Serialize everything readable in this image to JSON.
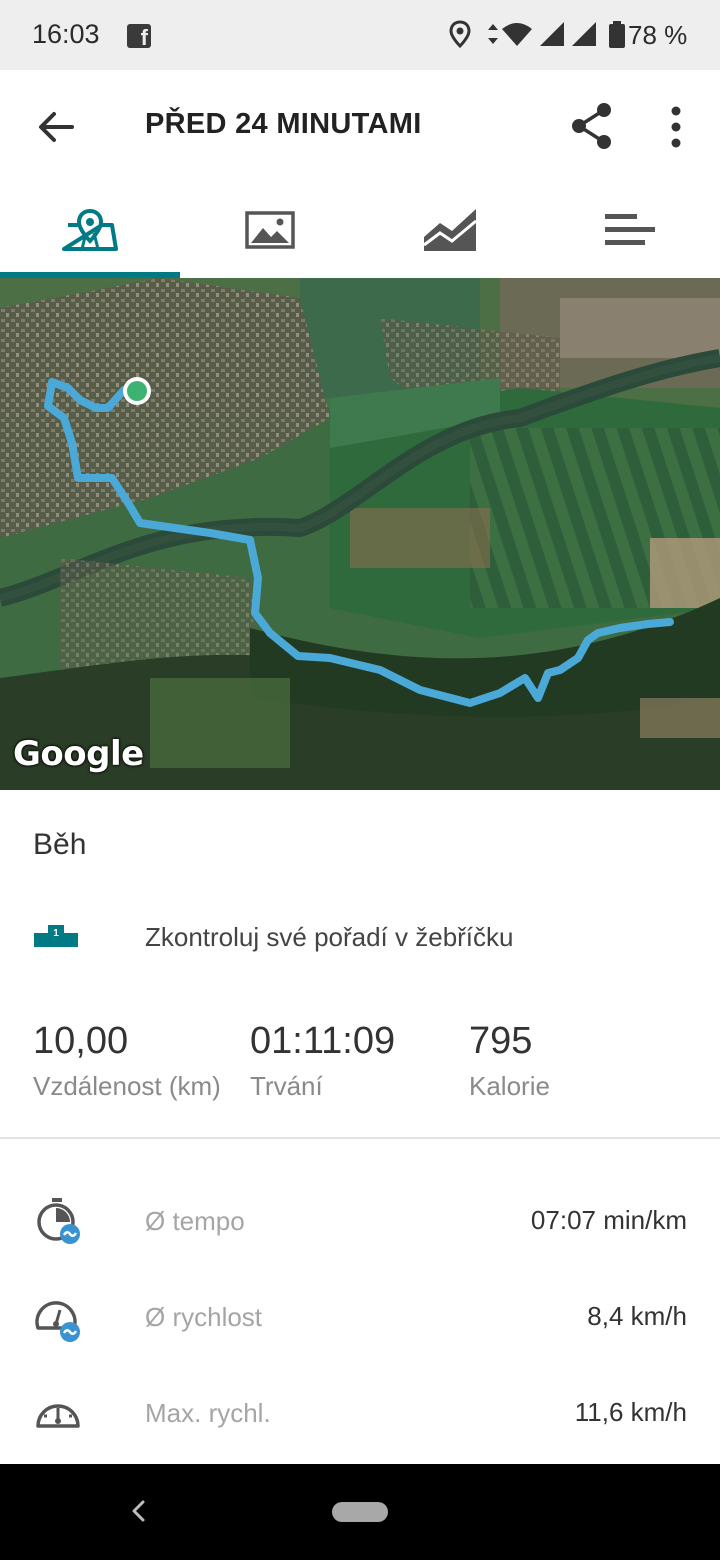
{
  "status_bar": {
    "time": "16:03",
    "battery_percent": "78 %",
    "icons": [
      "facebook-icon",
      "location-icon",
      "data-arrows-icon",
      "wifi-icon",
      "signal-icon",
      "signal-icon",
      "battery-icon"
    ]
  },
  "header": {
    "title": "PŘED 24 MINUTAMI",
    "back_icon": "arrow-back-icon",
    "share_icon": "share-icon",
    "more_icon": "more-vert-icon"
  },
  "tabs": [
    {
      "id": "map",
      "icon": "map-pin-icon",
      "active": true
    },
    {
      "id": "photos",
      "icon": "image-icon",
      "active": false
    },
    {
      "id": "charts",
      "icon": "area-chart-icon",
      "active": false
    },
    {
      "id": "details",
      "icon": "list-bars-icon",
      "active": false
    }
  ],
  "map": {
    "attribution": "Google",
    "route_color": "#4aa9d6",
    "start_marker_color": "#3cb371"
  },
  "activity": {
    "type": "Běh",
    "leaderboard_text": "Zkontroluj své pořadí v žebříčku"
  },
  "summary": [
    {
      "value": "10,00",
      "label": "Vzdálenost (km)"
    },
    {
      "value": "01:11:09",
      "label": "Trvání"
    },
    {
      "value": "795",
      "label": "Kalorie"
    }
  ],
  "metrics": [
    {
      "icon": "stopwatch-avg-icon",
      "label": "Ø tempo",
      "value": "07:07 min/km"
    },
    {
      "icon": "speedometer-avg-icon",
      "label": "Ø rychlost",
      "value": "8,4 km/h"
    },
    {
      "icon": "speedometer-icon",
      "label": "Max. rychl.",
      "value": "11,6 km/h"
    }
  ],
  "colors": {
    "accent": "#007b85",
    "label_grey": "#a5a5a5"
  }
}
